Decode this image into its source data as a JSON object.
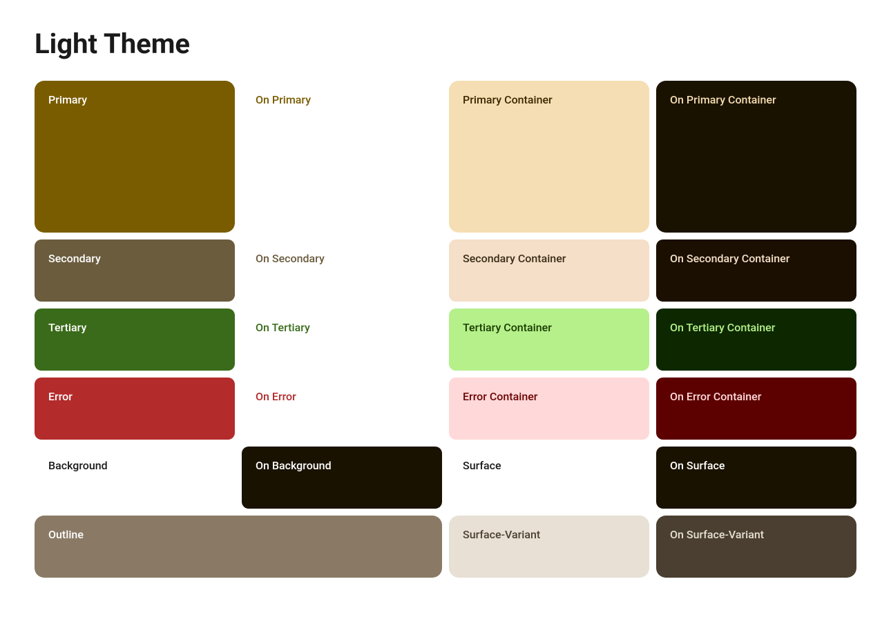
{
  "title": "Light Theme",
  "rows": [
    {
      "id": "primary-row",
      "cells": [
        {
          "id": "primary",
          "label": "Primary",
          "bg": "#7a5c00",
          "color": "#ffffff",
          "class": "primary-cell",
          "tall": true
        },
        {
          "id": "on-primary",
          "label": "On Primary",
          "bg": "#ffffff",
          "color": "#7a5c00",
          "class": "on-primary-cell",
          "tall": true
        },
        {
          "id": "primary-container",
          "label": "Primary Container",
          "bg": "#f5deb3",
          "color": "#3b2800",
          "class": "primary-container-cell",
          "tall": true
        },
        {
          "id": "on-primary-container",
          "label": "On Primary Container",
          "bg": "#1a1200",
          "color": "#f5deb3",
          "class": "on-primary-container-cell",
          "tall": true
        }
      ]
    },
    {
      "id": "secondary-row",
      "cells": [
        {
          "id": "secondary",
          "label": "Secondary",
          "bg": "#6b5c3e",
          "color": "#ffffff",
          "class": "secondary-cell"
        },
        {
          "id": "on-secondary",
          "label": "On Secondary",
          "bg": "#ffffff",
          "color": "#6b5c3e",
          "class": "on-secondary-cell"
        },
        {
          "id": "secondary-container",
          "label": "Secondary Container",
          "bg": "#f5dfc8",
          "color": "#3b2e1a",
          "class": "secondary-container-cell"
        },
        {
          "id": "on-secondary-container",
          "label": "On Secondary Container",
          "bg": "#1a0f00",
          "color": "#f5dfc8",
          "class": "on-secondary-container-cell"
        }
      ]
    },
    {
      "id": "tertiary-row",
      "cells": [
        {
          "id": "tertiary",
          "label": "Tertiary",
          "bg": "#3a6b1a",
          "color": "#ffffff",
          "class": "tertiary-cell"
        },
        {
          "id": "on-tertiary",
          "label": "On Tertiary",
          "bg": "#ffffff",
          "color": "#3a6b1a",
          "class": "on-tertiary-cell"
        },
        {
          "id": "tertiary-container",
          "label": "Tertiary Container",
          "bg": "#b5f08a",
          "color": "#1a3a00",
          "class": "tertiary-container-cell"
        },
        {
          "id": "on-tertiary-container",
          "label": "On Tertiary Container",
          "bg": "#0d2800",
          "color": "#b5f08a",
          "class": "on-tertiary-container-cell"
        }
      ]
    },
    {
      "id": "error-row",
      "cells": [
        {
          "id": "error",
          "label": "Error",
          "bg": "#b32b2b",
          "color": "#ffffff",
          "class": "error-cell"
        },
        {
          "id": "on-error",
          "label": "On Error",
          "bg": "#ffffff",
          "color": "#b32b2b",
          "class": "on-error-cell"
        },
        {
          "id": "error-container",
          "label": "Error Container",
          "bg": "#ffd9d9",
          "color": "#6b0000",
          "class": "error-container-cell"
        },
        {
          "id": "on-error-container",
          "label": "On Error Container",
          "bg": "#5c0000",
          "color": "#ffd9d9",
          "class": "on-error-container-cell"
        }
      ]
    },
    {
      "id": "background-row",
      "cells": [
        {
          "id": "background",
          "label": "Background",
          "bg": "#ffffff",
          "color": "#1a1a1a",
          "class": "background-cell"
        },
        {
          "id": "on-background",
          "label": "On Background",
          "bg": "#1a1200",
          "color": "#ffffff",
          "class": "on-background-cell"
        },
        {
          "id": "surface",
          "label": "Surface",
          "bg": "#ffffff",
          "color": "#1a1a1a",
          "class": "surface-cell"
        },
        {
          "id": "on-surface",
          "label": "On Surface",
          "bg": "#1a1200",
          "color": "#ffffff",
          "class": "on-surface-cell"
        }
      ]
    },
    {
      "id": "outline-row",
      "cells": [
        {
          "id": "outline",
          "label": "Outline",
          "bg": "#8a7a65",
          "color": "#ffffff",
          "class": "outline-cell",
          "span": 2
        },
        {
          "id": "surface-variant",
          "label": "Surface-Variant",
          "bg": "#e8e0d5",
          "color": "#4a3f30",
          "class": "surface-variant-cell"
        },
        {
          "id": "on-surface-variant",
          "label": "On Surface-Variant",
          "bg": "#4a3f30",
          "color": "#e8e0d5",
          "class": "on-surface-variant-cell"
        }
      ]
    }
  ]
}
